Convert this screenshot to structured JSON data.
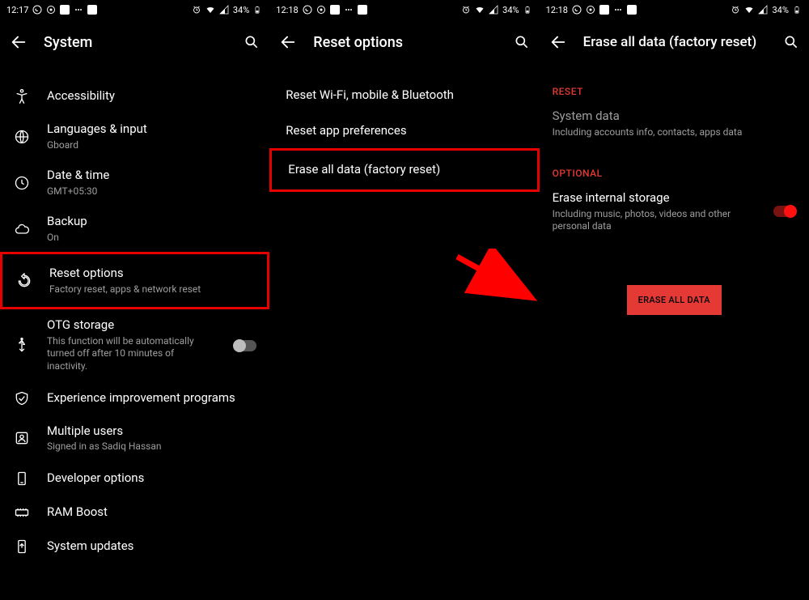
{
  "status": {
    "time1": "12:17",
    "time2": "12:18",
    "time3": "12:18",
    "battery": "34%"
  },
  "screen1": {
    "title": "System",
    "rows": {
      "accessibility": {
        "label": "Accessibility"
      },
      "languages": {
        "label": "Languages & input",
        "sub": "Gboard"
      },
      "datetime": {
        "label": "Date & time",
        "sub": "GMT+05:30"
      },
      "backup": {
        "label": "Backup",
        "sub": "On"
      },
      "reset": {
        "label": "Reset options",
        "sub": "Factory reset, apps & network reset"
      },
      "otg": {
        "label": "OTG storage",
        "sub": "This function will be automatically turned off after 10 minutes of inactivity."
      },
      "eip": {
        "label": "Experience improvement programs"
      },
      "multiuser": {
        "label": "Multiple users",
        "sub": "Signed in as Sadiq Hassan"
      },
      "devopt": {
        "label": "Developer options"
      },
      "ramboost": {
        "label": "RAM Boost"
      },
      "sysupdate": {
        "label": "System updates"
      }
    }
  },
  "screen2": {
    "title": "Reset options",
    "rows": {
      "wifi": {
        "label": "Reset Wi-Fi, mobile & Bluetooth"
      },
      "apps": {
        "label": "Reset app preferences"
      },
      "erase": {
        "label": "Erase all data (factory reset)"
      }
    }
  },
  "screen3": {
    "title": "Erase all data (factory reset)",
    "section_reset": "RESET",
    "system_data": {
      "label": "System data",
      "sub": "Including accounts info, contacts, apps data"
    },
    "section_optional": "OPTIONAL",
    "internal": {
      "label": "Erase internal storage",
      "sub": "Including music, photos, videos and other personal data"
    },
    "erase_btn": "ERASE ALL DATA"
  }
}
